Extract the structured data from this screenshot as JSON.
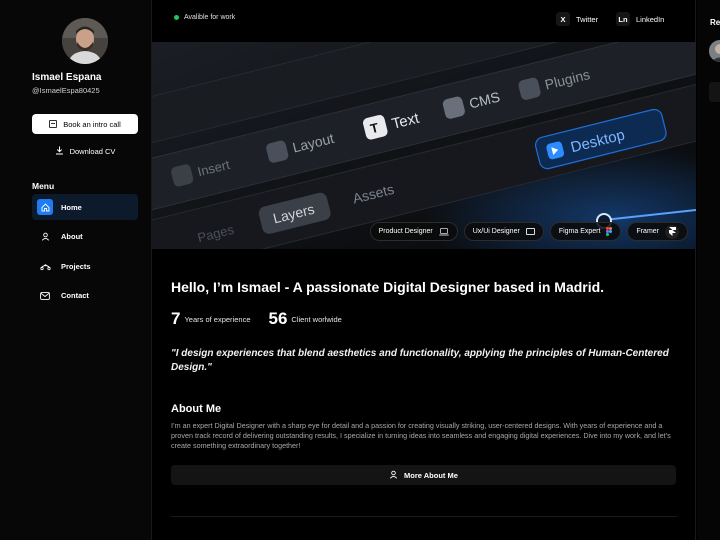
{
  "profile": {
    "name": "Ismael Espana",
    "handle": "@IsmaelEspa80425",
    "intro_button": "Book an intro call",
    "cv_button": "Download CV"
  },
  "menu": {
    "title": "Menu",
    "items": [
      {
        "label": "Home",
        "icon": "home-icon",
        "active": true
      },
      {
        "label": "About",
        "icon": "user-icon",
        "active": false
      },
      {
        "label": "Projects",
        "icon": "projects-icon",
        "active": false
      },
      {
        "label": "Contact",
        "icon": "mail-icon",
        "active": false
      }
    ]
  },
  "topbar": {
    "status": "Avalible for work",
    "social": [
      {
        "mark": "X",
        "label": "Twitter"
      },
      {
        "mark": "Ln",
        "label": "LinkedIn"
      }
    ]
  },
  "hero": {
    "ui_labels": {
      "insert": "Insert",
      "layout": "Layout",
      "text": "Text",
      "cms": "CMS",
      "plugins": "Plugins",
      "pages": "Pages",
      "layers": "Layers",
      "assets": "Assets",
      "desktop": "Desktop"
    },
    "chips": [
      {
        "label": "Product Designer",
        "icon": "laptop-icon"
      },
      {
        "label": "Ux/Ui Designer",
        "icon": "window-icon"
      },
      {
        "label": "Figma Expert",
        "icon": "figma-icon"
      },
      {
        "label": "Framer",
        "icon": "framer-icon"
      }
    ]
  },
  "intro": {
    "headline": "Hello, I’m Ismael - A passionate Digital Designer based in Madrid.",
    "stats": [
      {
        "number": "7",
        "label": "Years of experience"
      },
      {
        "number": "56",
        "label": "Client worlwide"
      }
    ],
    "quote": "\"I design experiences that blend aesthetics and functionality, applying the principles of Human-Centered Design.\""
  },
  "about": {
    "title": "About Me",
    "body": "I’m an expert Digital Designer with a sharp eye for detail and a passion for creating visually striking, user-centered designs. With years of experience and a proven track record of delivering outstanding results, I specialize in turning ideas into seamless and engaging digital experiences. Dive into my work, and let’s create something extraordinary together!",
    "button": "More About Me"
  },
  "right_panel": {
    "title": "Re"
  },
  "colors": {
    "background": "#000000",
    "accent_blue": "#1e7bf2",
    "status_green": "#21c55d"
  }
}
